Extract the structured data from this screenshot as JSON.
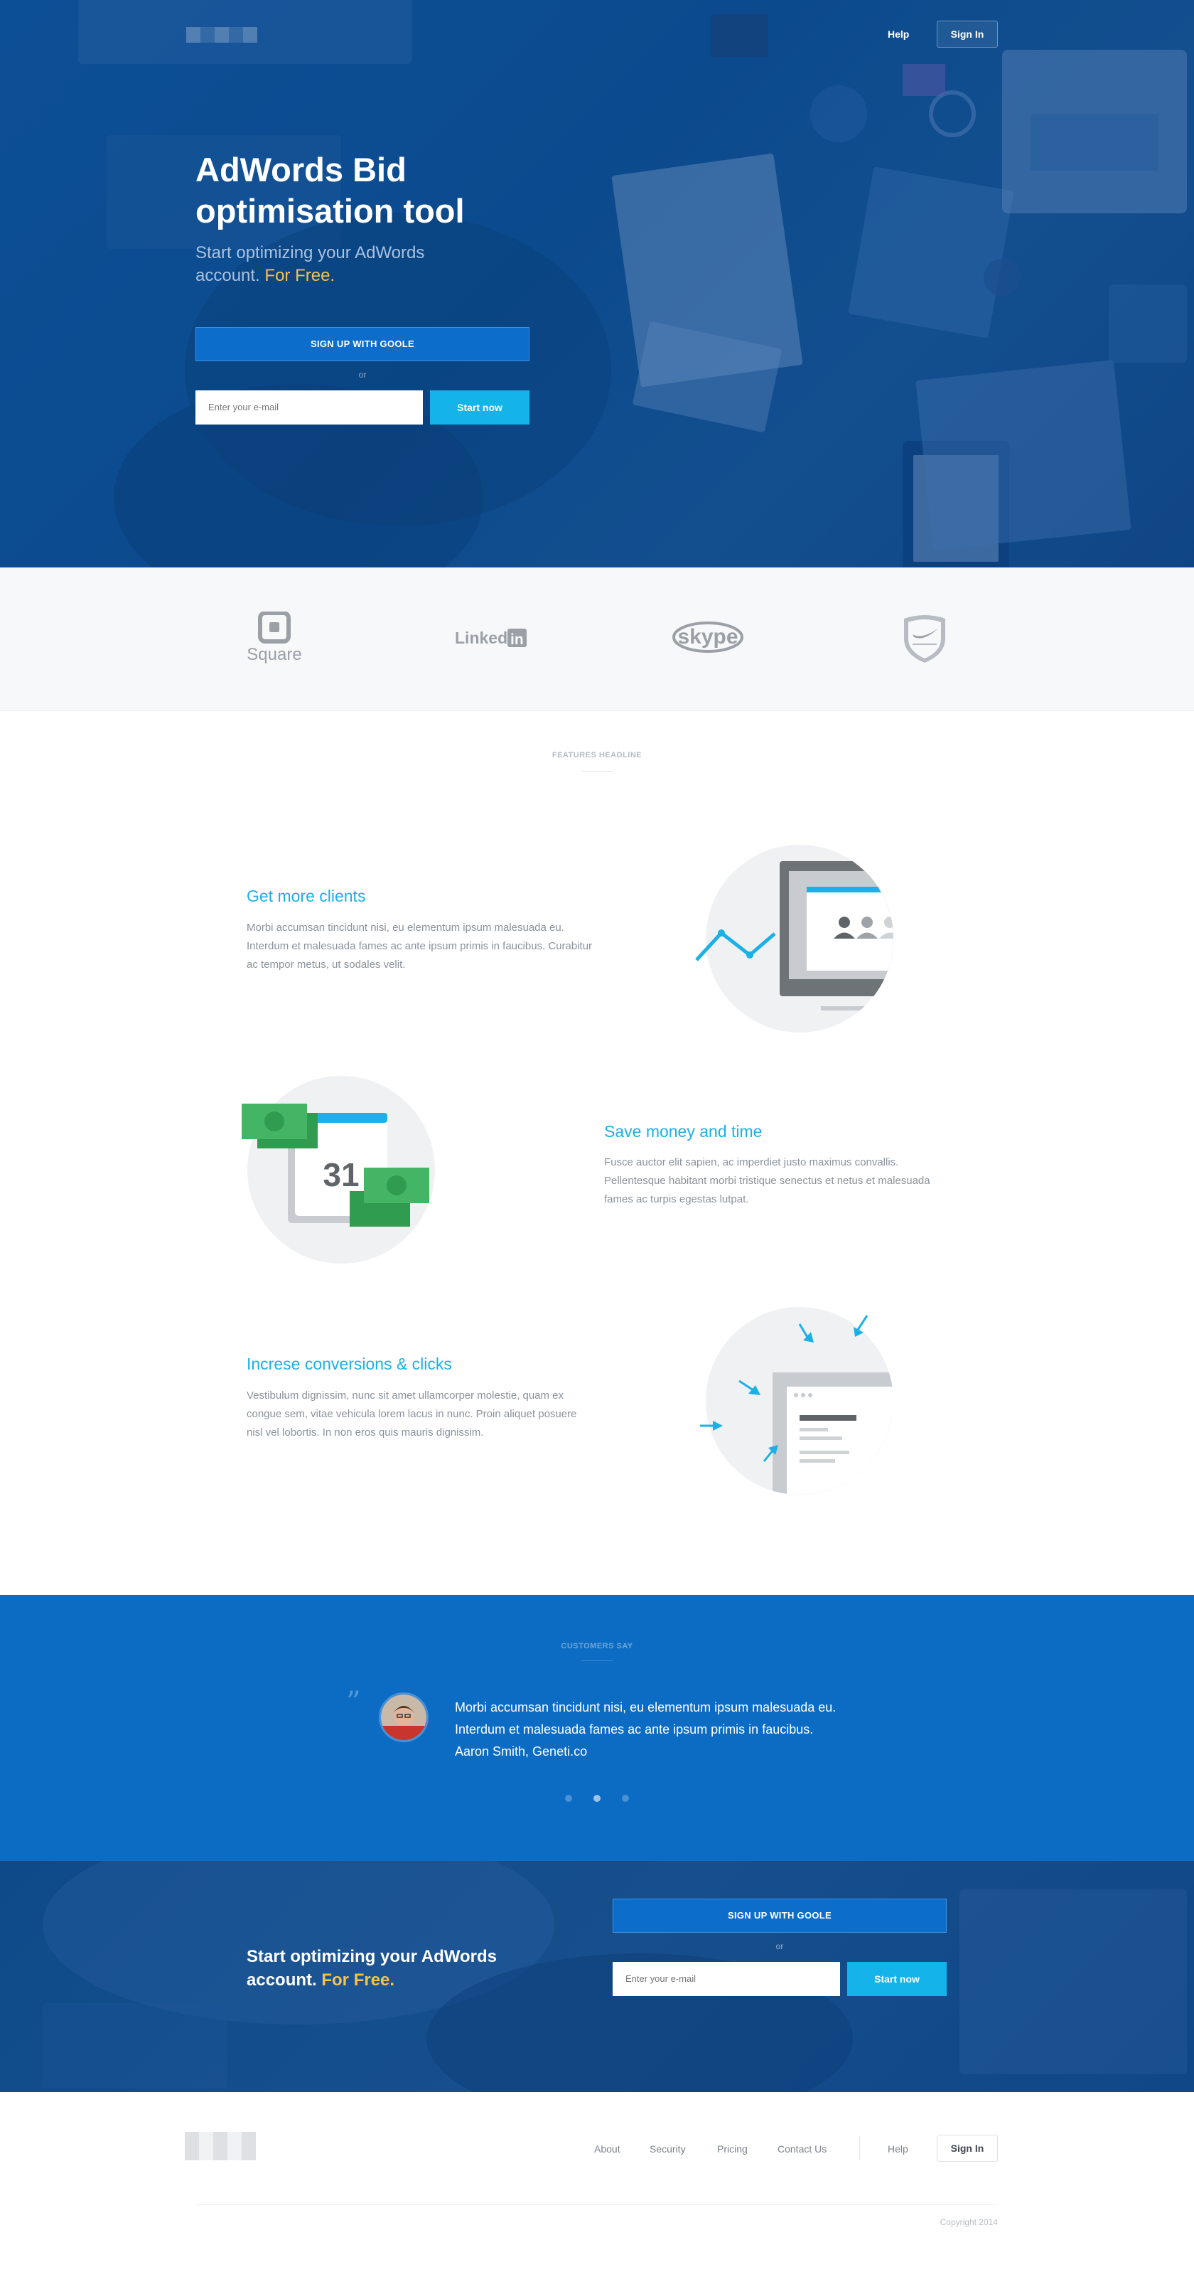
{
  "header": {
    "help_label": "Help",
    "signin_label": "Sign In"
  },
  "hero": {
    "title": "AdWords Bid optimisation tool",
    "subtitle_plain": "Start optimizing your AdWords account.",
    "subtitle_accent": "For Free.",
    "google_button": "SIGN UP WITH GOOLE",
    "or": "or",
    "email_placeholder": "Enter your e-mail",
    "start_button": "Start now"
  },
  "logos": {
    "items": [
      "Square",
      "LinkedIn",
      "skype",
      "Nike shield"
    ]
  },
  "features": {
    "headline": "FEATURES HEADLINE",
    "items": [
      {
        "title": "Get more clients",
        "text": "Morbi accumsan tincidunt nisi, eu elementum ipsum malesuada eu. Interdum et malesuada fames ac ante ipsum primis in faucibus. Curabitur ac tempor metus, ut sodales velit."
      },
      {
        "title": "Save money and time",
        "text": "Fusce auctor elit sapien, ac imperdiet justo maximus convallis. Pellentesque habitant morbi tristique senectus et netus et malesuada fames ac turpis egestas lutpat.",
        "calendar_day": "31"
      },
      {
        "title": "Increse conversions & clicks",
        "text": "Vestibulum dignissim, nunc sit amet ullamcorper molestie, quam ex congue sem, vitae vehicula lorem lacus in nunc. Proin aliquet posuere nisl vel lobortis. In non eros quis mauris dignissim."
      }
    ]
  },
  "testimonial": {
    "headline": "CUSTOMERS SAY",
    "quote_line1": "Morbi accumsan tincidunt nisi, eu elementum ipsum malesuada eu.",
    "quote_line2": "Interdum et malesuada fames ac ante ipsum primis in faucibus.",
    "author": "Aaron Smith, Geneti.co",
    "active_slide": 2,
    "slide_count": 3
  },
  "cta": {
    "title_plain": "Start optimizing your AdWords account.",
    "title_accent": "For Free.",
    "google_button": "SIGN UP WITH GOOLE",
    "or": "or",
    "email_placeholder": "Enter your e-mail",
    "start_button": "Start now"
  },
  "footer": {
    "links": [
      "About",
      "Security",
      "Pricing",
      "Contact Us"
    ],
    "help_label": "Help",
    "signin_label": "Sign In",
    "copyright": "Copyright 2014"
  },
  "colors": {
    "hero_blue": "#0d4f96",
    "brand_blue": "#0c6cc4",
    "cyan_accent": "#14b3ea",
    "yellow_accent": "#f5c24c"
  }
}
